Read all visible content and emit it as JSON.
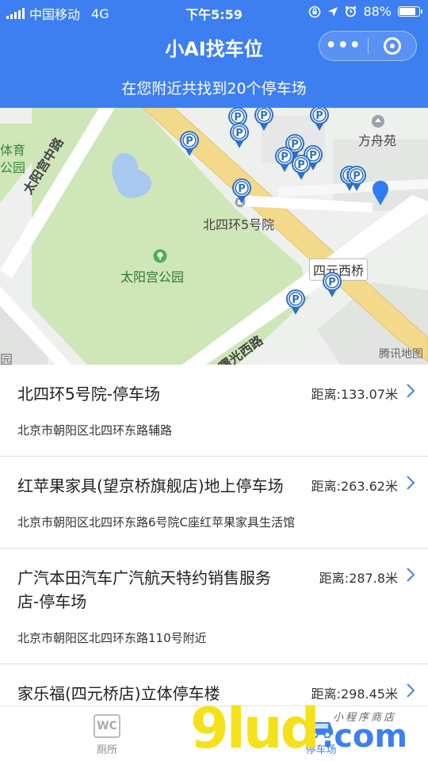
{
  "status": {
    "carrier": "中国移动",
    "network": "4G",
    "time": "下午5:59",
    "battery_text": "88%",
    "battery_level": 0.88
  },
  "nav": {
    "title": "小AI找车位",
    "more": "•••"
  },
  "summary": "在您附近共找到20个停车场",
  "map": {
    "labels": {
      "fangzhouyuan": "方舟苑",
      "tiyu": "体育",
      "gongyuan": "公园",
      "taiyanggong_road": "太阳宫中路",
      "beisihuan5": "北四环5号院",
      "taiyanggong_park": "太阳宫公园",
      "siyuanxiqiao": "四元西桥",
      "shuguangxilu": "曙光西路",
      "yuan": "园",
      "provider": "腾讯地图"
    },
    "marker_symbol": "P",
    "colors": {
      "park_green": "#cfe6b8",
      "road_yellow": "#f3d98a",
      "marker_blue": "#2e6fc8",
      "location_blue": "#2f7bf0"
    }
  },
  "parking_lots": [
    {
      "name": "北四环5号院-停车场",
      "distance": "距离:133.07米",
      "address": "北京市朝阳区北四环东路辅路"
    },
    {
      "name": "红苹果家具(望京桥旗舰店)地上停车场",
      "distance": "距离:263.62米",
      "address": "北京市朝阳区北四环东路6号院C座红苹果家具生活馆"
    },
    {
      "name": "广汽本田汽车广汽航天特约销售服务店-停车场",
      "distance": "距离:287.8米",
      "address": "北京市朝阳区北四环东路110号附近"
    },
    {
      "name": "家乐福(四元桥店)立体停车楼",
      "distance": "距离:298.45米",
      "address": ""
    }
  ],
  "tabs": [
    {
      "label": "厕所",
      "icon": "wc-icon",
      "glyph": "WC"
    },
    {
      "label": "停车场",
      "icon": "car-icon"
    }
  ],
  "brand_watermark": {
    "logo": "9lud",
    "suffix": ".com",
    "tagline": "小程序商店"
  }
}
